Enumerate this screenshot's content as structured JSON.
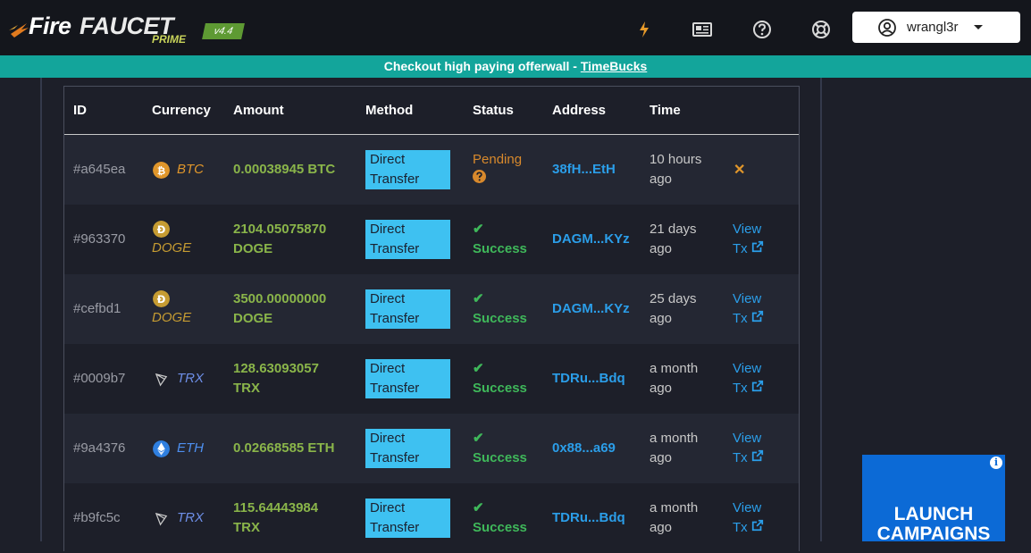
{
  "header": {
    "logo_fire": "Fire",
    "logo_faucet": "FAUCET",
    "logo_prime": "PRIME",
    "logo_version": "v4.4",
    "icons": [
      "lightning-icon",
      "newspaper-icon",
      "help-icon",
      "support-icon"
    ],
    "user": {
      "name": "wrangl3r"
    }
  },
  "notice": {
    "text": "Checkout high paying offerwall - ",
    "link": "TimeBucks"
  },
  "table": {
    "columns": [
      "ID",
      "Currency",
      "Amount",
      "Method",
      "Status",
      "Address",
      "Time"
    ],
    "rows": [
      {
        "id": "#a645ea",
        "currency": "BTC",
        "amount": "0.00038945 BTC",
        "method": "Direct Transfer",
        "status": "Pending",
        "address": "38fH...EtH",
        "time": "10 hours ago"
      },
      {
        "id": "#963370",
        "currency": "DOGE",
        "amount": "2104.05075870 DOGE",
        "method": "Direct Transfer",
        "status": "Success",
        "address": "DAGM...KYz",
        "time": "21 days ago",
        "action": "View Tx"
      },
      {
        "id": "#cefbd1",
        "currency": "DOGE",
        "amount": "3500.00000000 DOGE",
        "method": "Direct Transfer",
        "status": "Success",
        "address": "DAGM...KYz",
        "time": "25 days ago",
        "action": "View Tx"
      },
      {
        "id": "#0009b7",
        "currency": "TRX",
        "amount": "128.63093057 TRX",
        "method": "Direct Transfer",
        "status": "Success",
        "address": "TDRu...Bdq",
        "time": "a month ago",
        "action": "View Tx"
      },
      {
        "id": "#9a4376",
        "currency": "ETH",
        "amount": "0.02668585 ETH",
        "method": "Direct Transfer",
        "status": "Success",
        "address": "0x88...a69",
        "time": "a month ago",
        "action": "View Tx"
      },
      {
        "id": "#b9fc5c",
        "currency": "TRX",
        "amount": "115.64443984 TRX",
        "method": "Direct Transfer",
        "status": "Success",
        "address": "TDRu...Bdq",
        "time": "a month ago",
        "action": "View Tx"
      }
    ]
  },
  "colors": {
    "accent": "#13a59b",
    "success": "#3fb85a",
    "pending": "#d8892c",
    "link": "#2b9ee9",
    "method_bg": "#3ec1f1",
    "amount": "#8ab54a",
    "btc": "#e0962b",
    "doge": "#c69c32",
    "eth": "#2f7fe0",
    "trx_label": "#6e8fe8"
  },
  "ad": {
    "text": "LAUNCH CAMPAIGNS",
    "info": "i"
  }
}
